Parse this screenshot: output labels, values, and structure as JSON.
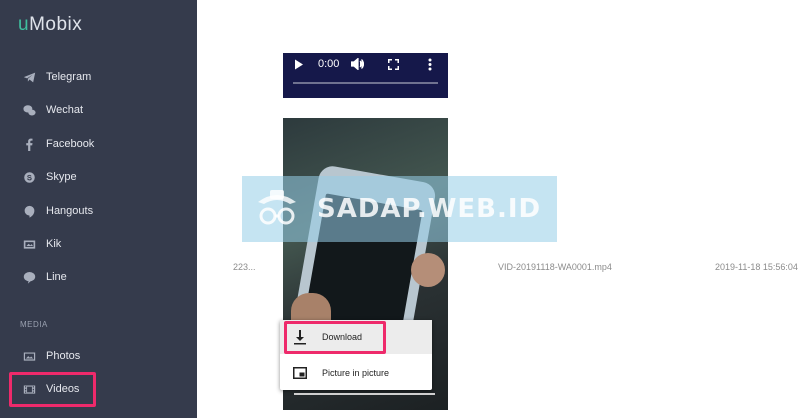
{
  "app": {
    "logo_u": "u",
    "logo_rest": "Mobix"
  },
  "sidebar": {
    "items": [
      {
        "label": "Telegram",
        "icon": "telegram-icon"
      },
      {
        "label": "Wechat",
        "icon": "wechat-icon"
      },
      {
        "label": "Facebook",
        "icon": "facebook-icon"
      },
      {
        "label": "Skype",
        "icon": "skype-icon"
      },
      {
        "label": "Hangouts",
        "icon": "hangouts-icon"
      },
      {
        "label": "Kik",
        "icon": "kik-icon"
      },
      {
        "label": "Line",
        "icon": "line-icon"
      }
    ],
    "section_label": "MEDIA",
    "media_items": [
      {
        "label": "Photos",
        "icon": "photos-icon"
      },
      {
        "label": "Videos",
        "icon": "videos-icon"
      }
    ]
  },
  "video_player": {
    "time": "0:00"
  },
  "file_row": {
    "size": "223...",
    "filename": "VID-20191118-WA0001.mp4",
    "datetime": "2019-11-18 15:56:04"
  },
  "context_menu": {
    "items": [
      {
        "label": "Download",
        "icon": "download-icon"
      },
      {
        "label": "Picture in picture",
        "icon": "picture-in-picture-icon"
      }
    ]
  },
  "watermark": {
    "text": "SADAP.WEB.ID"
  },
  "colors": {
    "sidebar_bg": "#353b4c",
    "accent": "#3fbf9f",
    "highlight": "#ee2a6b"
  }
}
